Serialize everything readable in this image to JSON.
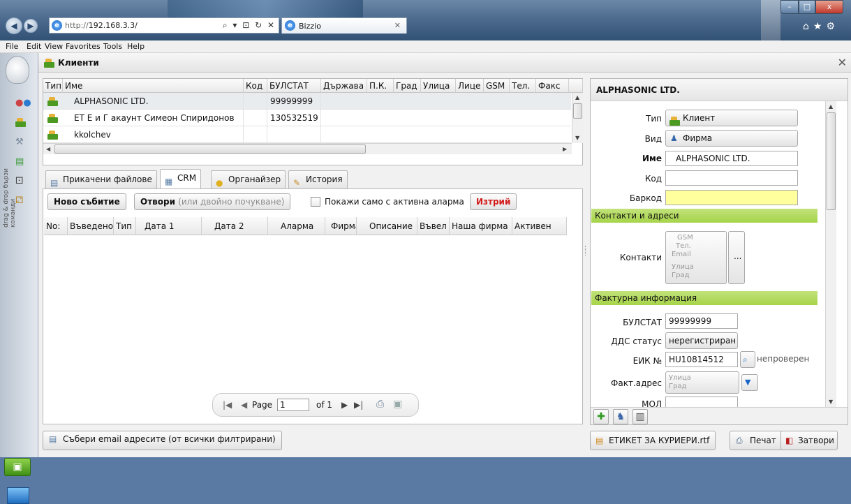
{
  "browser": {
    "url_protocol": "http://",
    "url_host": "192.168.3.3/",
    "addr_controls": "⌕ ▾ ⊡ ↻ ✕",
    "tab_title": "Bizzio",
    "tab_close": "✕",
    "menu": [
      "File",
      "Edit",
      "View",
      "Favorites",
      "Tools",
      "Help"
    ],
    "win_min": "–",
    "win_max": "□",
    "win_close": "x",
    "toolicons": "⌂★⚙"
  },
  "leftbar": {
    "drag_text": "drag & drop бързи команди"
  },
  "app": {
    "title": "Клиенти",
    "close": "✕"
  },
  "clients": {
    "columns": [
      "Тип",
      "Име",
      "Код",
      "БУЛСТАТ",
      "Държава",
      "П.К.",
      "Град",
      "Улица",
      "Лице",
      "GSM",
      "Тел.",
      "Факс"
    ],
    "rows": [
      {
        "name": "ALPHASONIC LTD.",
        "code": "",
        "bulstat": "99999999"
      },
      {
        "name": "ЕТ Е и Г акаунт  Симеон Спиридонов",
        "code": "",
        "bulstat": "130532519"
      },
      {
        "name": "kkolchev",
        "code": "",
        "bulstat": ""
      }
    ]
  },
  "tabs": [
    {
      "label": "Прикачени файлове"
    },
    {
      "label": "CRM"
    },
    {
      "label": "Органайзер"
    },
    {
      "label": "История"
    }
  ],
  "crm": {
    "new_event": "Ново събитие",
    "open_main": "Отвори",
    "open_hint": "(или двойно почукване)",
    "only_alarm": "Покажи само с активна аларма",
    "delete": "Изтрий",
    "columns": [
      "No:",
      "Въведено",
      "Тип",
      "Дата 1",
      "Дата 2",
      "Аларма",
      "Фирма",
      "Описание",
      "Въвел",
      "Наша фирма",
      "Активен"
    ],
    "pager": {
      "page_label": "Page",
      "page_value": "1",
      "of_label": "of 1"
    }
  },
  "collect_emails": "Събери email адресите (от всички филтрирани)",
  "detail": {
    "title": "ALPHASONIC LTD.",
    "type_label": "Тип",
    "type_value": "Клиент",
    "kind_label": "Вид",
    "kind_value": "Фирма",
    "name_label": "Име",
    "name_value": "ALPHASONIC LTD.",
    "code_label": "Код",
    "code_value": "",
    "barcode_label": "Баркод",
    "barcode_value": "",
    "section_contacts": "Контакти и адреси",
    "contacts_label": "Контакти",
    "contacts_ghost": [
      "GSM",
      "Тел.",
      "Email",
      "Улица",
      "Град"
    ],
    "contacts_more": "...",
    "section_invoice": "Фактурна информация",
    "bulstat_label": "БУЛСТАТ",
    "bulstat_value": "99999999",
    "vat_label": "ДДС статус",
    "vat_value": "нерегистриран",
    "eik_label": "ЕИК №",
    "eik_value": "HU10814512",
    "eik_status": "непроверен",
    "invaddr_label": "Факт.адрес",
    "invaddr_ghost": [
      "Улица",
      "Град"
    ],
    "mol_label": "МОЛ"
  },
  "bottom": {
    "label_file": "ЕТИКЕТ ЗА КУРИЕРИ.rtf",
    "print": "Печат",
    "close": "Затвори"
  },
  "colors": {
    "section_green": "#a6d44a",
    "delete_red": "#d11a1a",
    "barcode_yellow": "#ffff9e"
  }
}
